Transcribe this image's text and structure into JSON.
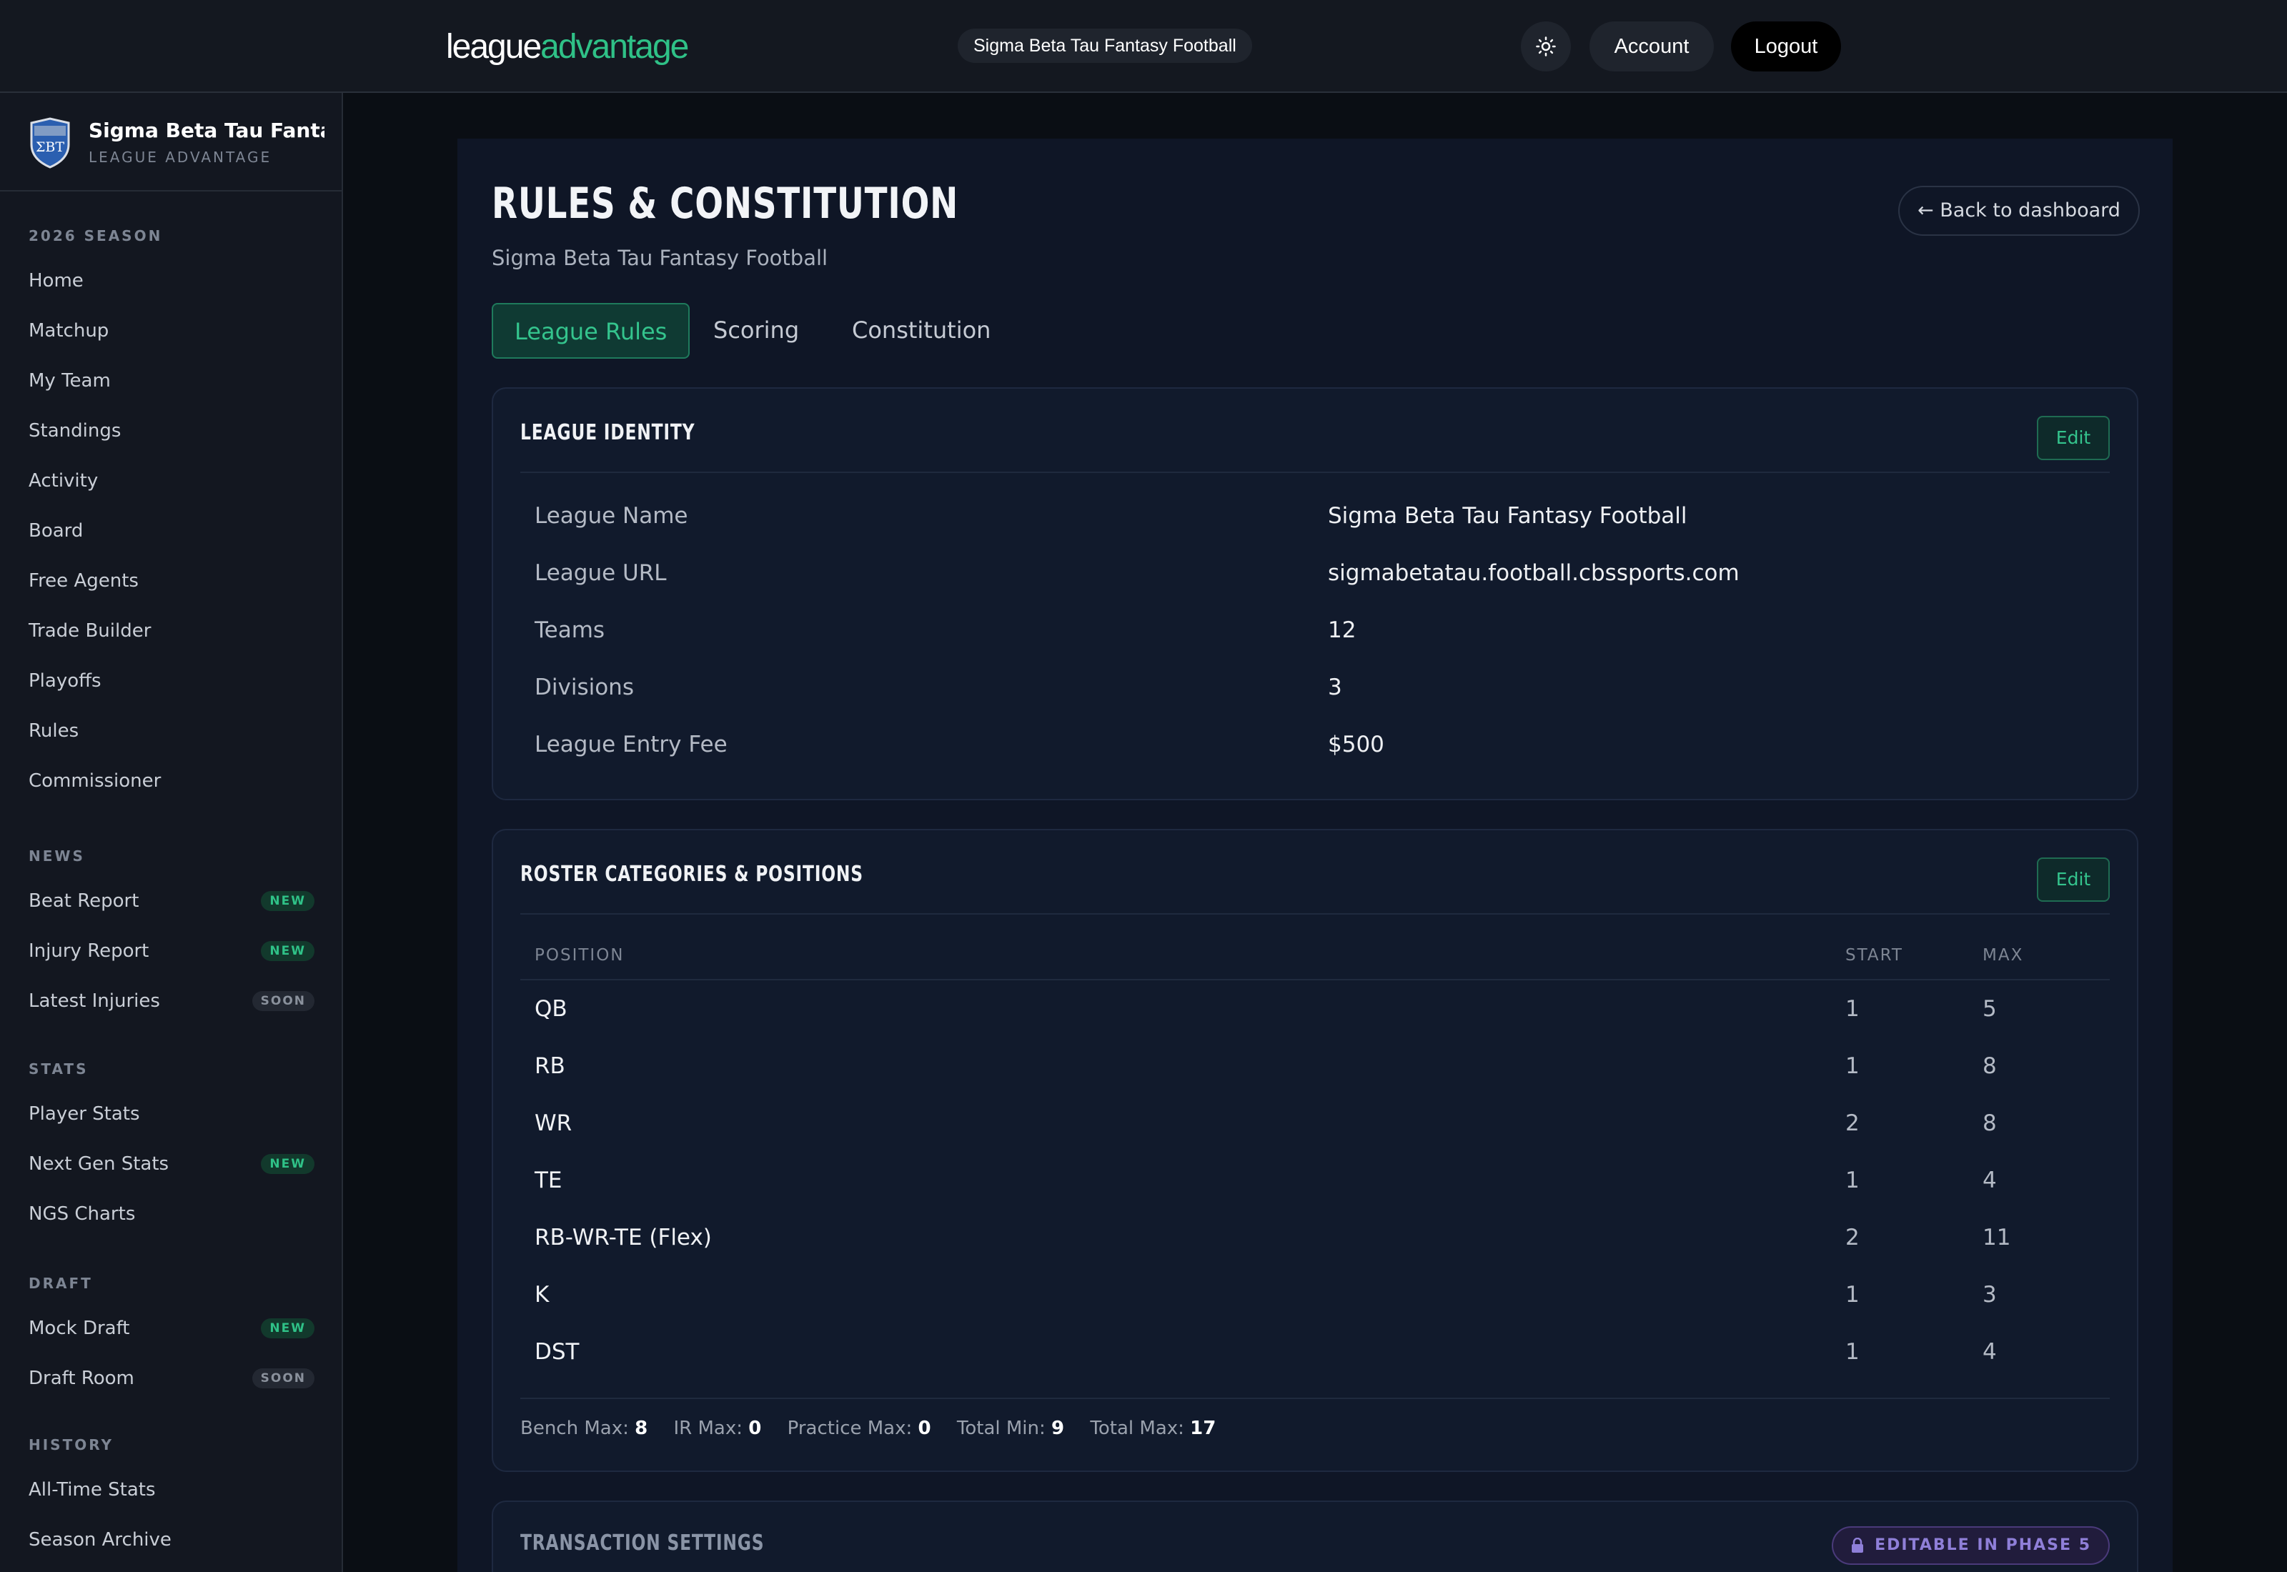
{
  "header": {
    "logo_part1": "league",
    "logo_part2": "advantage",
    "league_pill": "Sigma Beta Tau Fantasy Football",
    "account_label": "Account",
    "logout_label": "Logout"
  },
  "sidebar": {
    "title": "Sigma Beta Tau Fanta...",
    "subtitle": "LEAGUE ADVANTAGE",
    "logo_letters": "ΣBT",
    "sections": [
      {
        "label": "2026 SEASON",
        "items": [
          {
            "label": "Home"
          },
          {
            "label": "Matchup"
          },
          {
            "label": "My Team"
          },
          {
            "label": "Standings"
          },
          {
            "label": "Activity"
          },
          {
            "label": "Board"
          },
          {
            "label": "Free Agents"
          },
          {
            "label": "Trade Builder"
          },
          {
            "label": "Playoffs"
          },
          {
            "label": "Rules"
          },
          {
            "label": "Commissioner"
          }
        ]
      },
      {
        "label": "NEWS",
        "items": [
          {
            "label": "Beat Report",
            "badge": "NEW"
          },
          {
            "label": "Injury Report",
            "badge": "NEW"
          },
          {
            "label": "Latest Injuries",
            "badge": "SOON"
          }
        ]
      },
      {
        "label": "STATS",
        "items": [
          {
            "label": "Player Stats"
          },
          {
            "label": "Next Gen Stats",
            "badge": "NEW"
          },
          {
            "label": "NGS Charts"
          }
        ]
      },
      {
        "label": "DRAFT",
        "items": [
          {
            "label": "Mock Draft",
            "badge": "NEW"
          },
          {
            "label": "Draft Room",
            "badge": "SOON"
          }
        ]
      },
      {
        "label": "HISTORY",
        "items": [
          {
            "label": "All-Time Stats"
          },
          {
            "label": "Season Archive"
          }
        ]
      }
    ]
  },
  "page": {
    "title": "RULES & CONSTITUTION",
    "subtitle": "Sigma Beta Tau Fantasy Football",
    "back_label": "← Back to dashboard",
    "tabs": [
      {
        "label": "League Rules",
        "active": true
      },
      {
        "label": "Scoring",
        "active": false
      },
      {
        "label": "Constitution",
        "active": false
      }
    ]
  },
  "identity": {
    "title": "LEAGUE IDENTITY",
    "edit_label": "Edit",
    "rows": [
      {
        "label": "League Name",
        "value": "Sigma Beta Tau Fantasy Football"
      },
      {
        "label": "League URL",
        "value": "sigmabetatau.football.cbssports.com"
      },
      {
        "label": "Teams",
        "value": "12"
      },
      {
        "label": "Divisions",
        "value": "3"
      },
      {
        "label": "League Entry Fee",
        "value": "$500"
      }
    ]
  },
  "roster": {
    "title": "ROSTER CATEGORIES & POSITIONS",
    "edit_label": "Edit",
    "columns": [
      "POSITION",
      "START",
      "MAX"
    ],
    "rows": [
      {
        "position": "QB",
        "start": "1",
        "max": "5"
      },
      {
        "position": "RB",
        "start": "1",
        "max": "8"
      },
      {
        "position": "WR",
        "start": "2",
        "max": "8"
      },
      {
        "position": "TE",
        "start": "1",
        "max": "4"
      },
      {
        "position": "RB-WR-TE (Flex)",
        "start": "2",
        "max": "11"
      },
      {
        "position": "K",
        "start": "1",
        "max": "3"
      },
      {
        "position": "DST",
        "start": "1",
        "max": "4"
      }
    ],
    "totals": [
      {
        "label": "Bench Max:",
        "value": "8"
      },
      {
        "label": "IR Max:",
        "value": "0"
      },
      {
        "label": "Practice Max:",
        "value": "0"
      },
      {
        "label": "Total Min:",
        "value": "9"
      },
      {
        "label": "Total Max:",
        "value": "17"
      }
    ]
  },
  "transactions": {
    "title": "TRANSACTION SETTINGS",
    "badge_label": "EDITABLE IN PHASE 5"
  },
  "colors": {
    "accent": "#2fc187",
    "background": "#0a0e14",
    "panel": "#0f1626",
    "card": "#111a2c",
    "phase_badge": "#8f7fd8"
  },
  "icons": {
    "theme": "sun-icon",
    "back": "arrow-left-icon",
    "lock": "lock-icon",
    "league_logo": "shield-icon"
  }
}
